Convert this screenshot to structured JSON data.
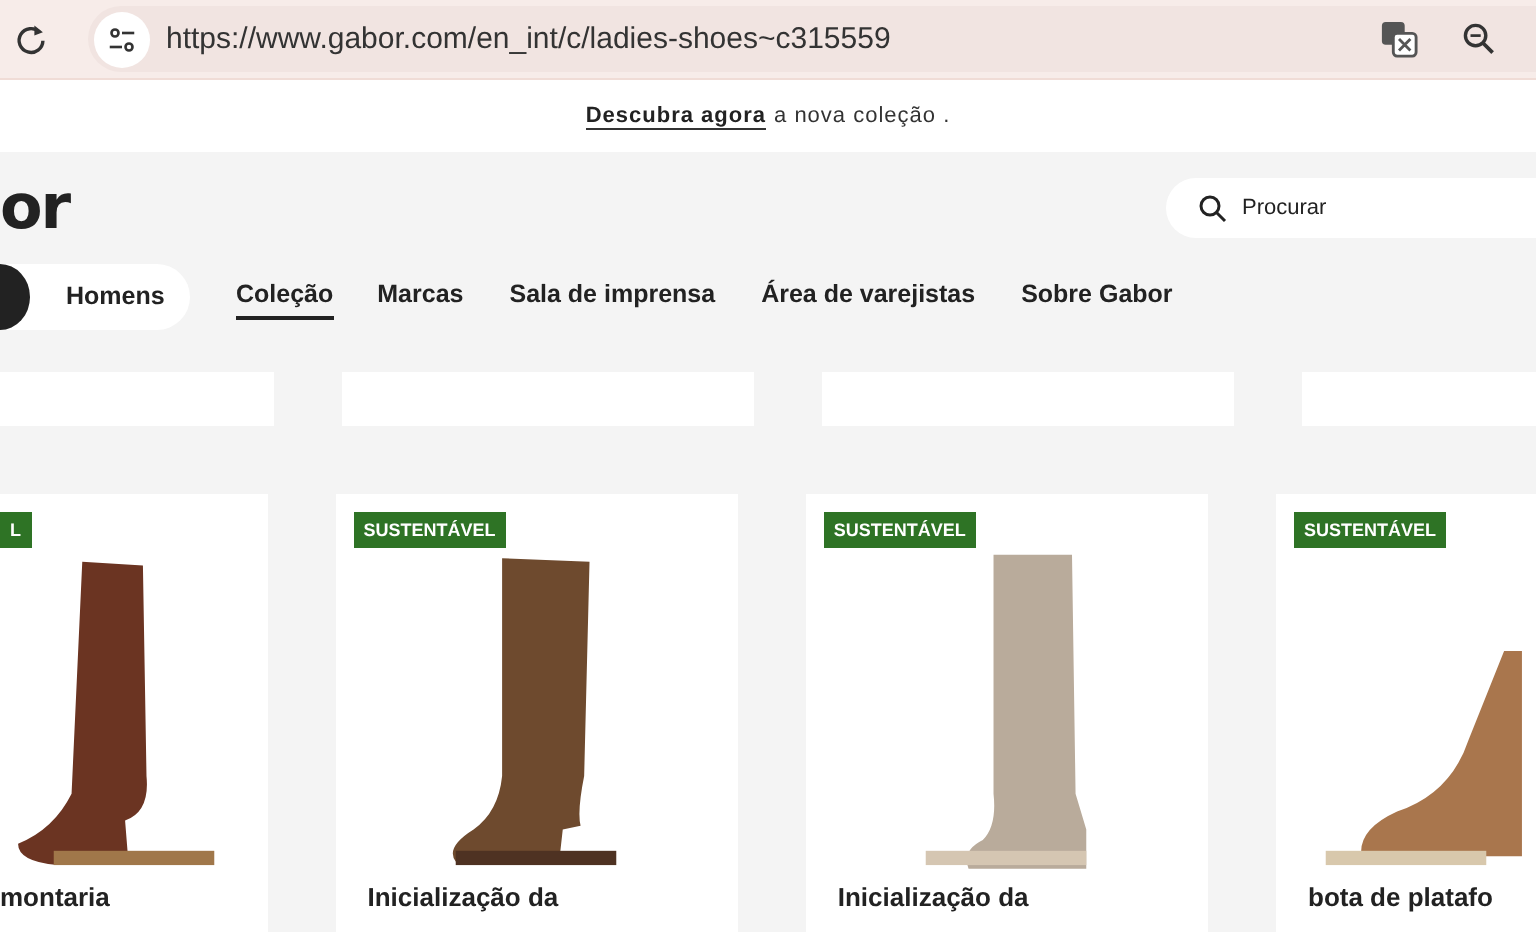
{
  "browser": {
    "url": "https://www.gabor.com/en_int/c/ladies-shoes~c315559"
  },
  "announcement": {
    "link": "Descubra agora",
    "text": "a nova coleção ."
  },
  "header": {
    "logo": "or",
    "search": {
      "placeholder": "Procurar"
    },
    "gender_toggle": {
      "label": "Homens"
    },
    "nav": [
      {
        "label": "Coleção",
        "selected": true
      },
      {
        "label": "Marcas",
        "selected": false
      },
      {
        "label": "Sala de imprensa",
        "selected": false
      },
      {
        "label": "Área de varejistas",
        "selected": false
      },
      {
        "label": "Sobre Gabor",
        "selected": false
      }
    ]
  },
  "products": [
    {
      "badge": "L",
      "title": "montaria",
      "kind": "tall-leather"
    },
    {
      "badge": "SUSTENTÁVEL",
      "title": "Inicialização da",
      "kind": "suede-brown"
    },
    {
      "badge": "SUSTENTÁVEL",
      "title": "Inicialização da",
      "kind": "suede-taupe"
    },
    {
      "badge": "SUSTENTÁVEL",
      "title": "bota de platafo",
      "kind": "lace-up"
    }
  ]
}
